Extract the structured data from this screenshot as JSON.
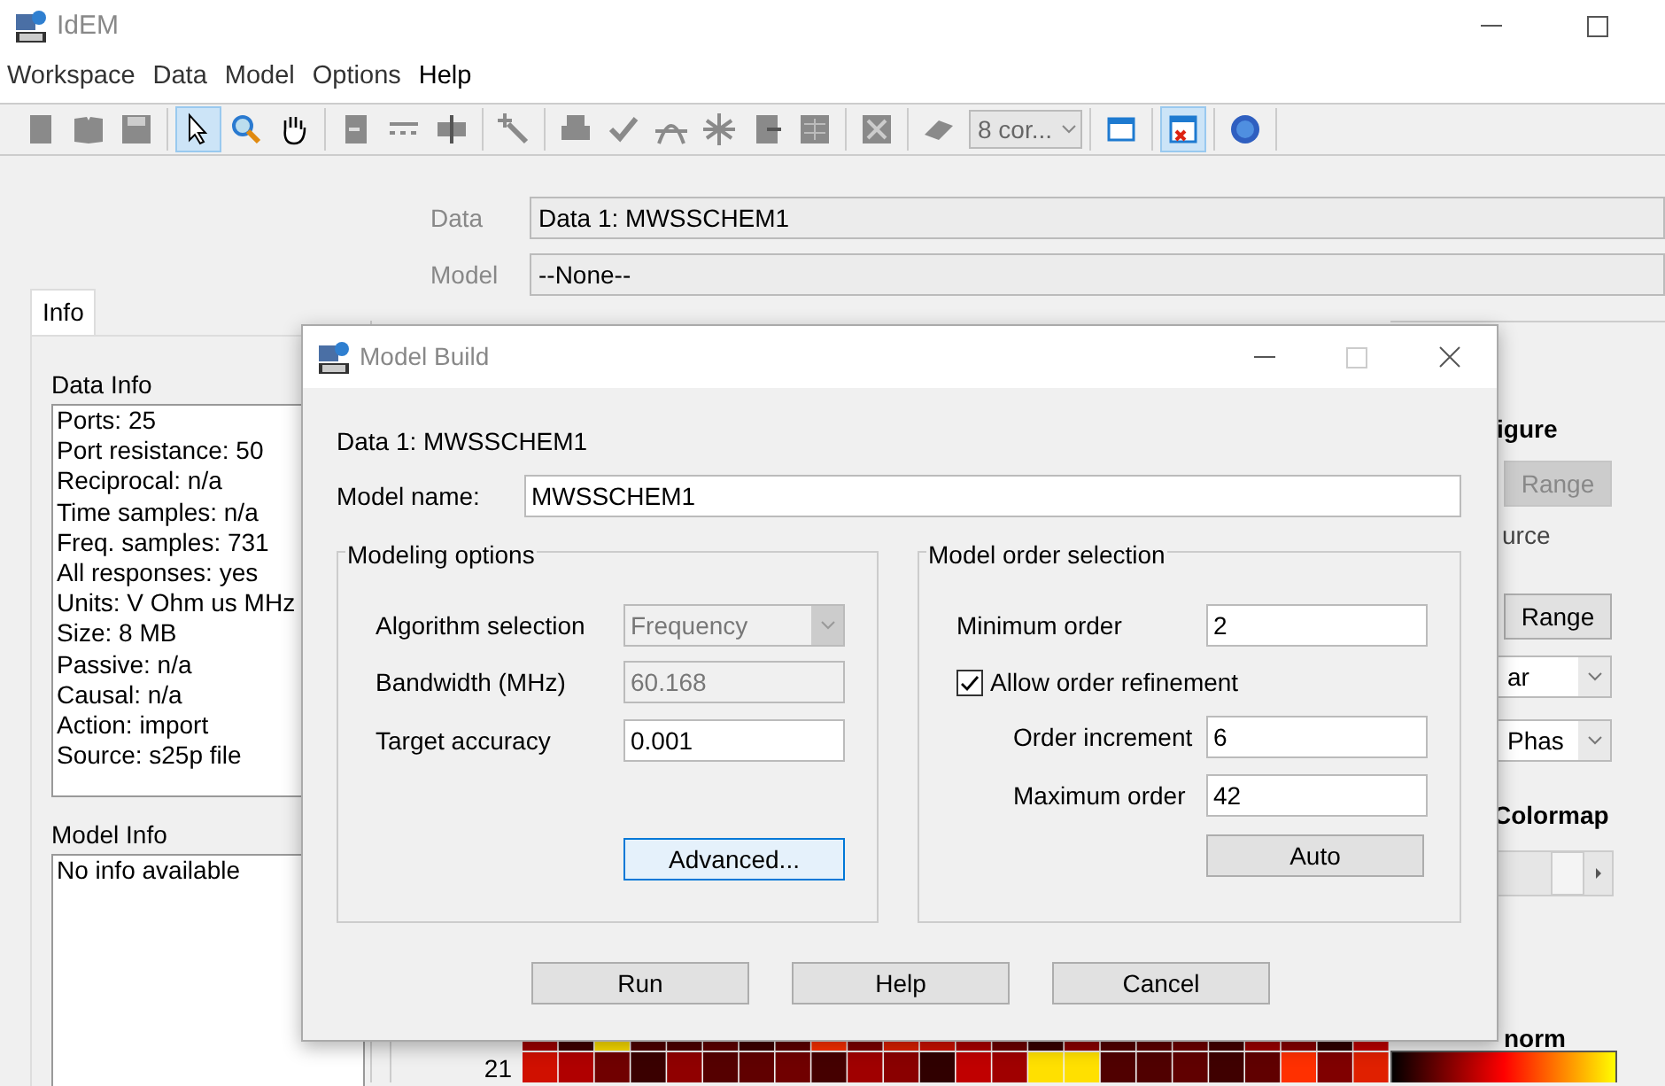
{
  "window": {
    "title": "IdEM"
  },
  "menu": [
    {
      "label": "Workspace",
      "selected": false
    },
    {
      "label": "Data",
      "selected": false
    },
    {
      "label": "Model",
      "selected": false
    },
    {
      "label": "Options",
      "selected": false
    },
    {
      "label": "Help",
      "selected": true
    }
  ],
  "toolbar": [
    [
      {
        "kind": "button",
        "selected": false
      },
      {
        "kind": "button",
        "selected": false
      },
      {
        "kind": "button",
        "selected": false
      }
    ],
    [
      {
        "kind": "button",
        "selected": true
      },
      {
        "kind": "button",
        "selected": false
      },
      {
        "kind": "button",
        "selected": false
      }
    ],
    [
      {
        "kind": "button",
        "selected": false
      },
      {
        "kind": "button",
        "selected": false
      },
      {
        "kind": "button",
        "selected": false
      }
    ],
    [
      {
        "kind": "button",
        "selected": false
      }
    ],
    [
      {
        "kind": "button",
        "selected": false
      },
      {
        "kind": "button",
        "selected": false
      },
      {
        "kind": "button",
        "selected": false
      },
      {
        "kind": "button",
        "selected": false
      },
      {
        "kind": "button",
        "selected": false
      },
      {
        "kind": "button",
        "selected": false
      }
    ],
    [
      {
        "kind": "button",
        "selected": false
      }
    ],
    [
      {
        "kind": "button",
        "selected": false
      },
      {
        "kind": "combo",
        "value": "8 cor..."
      }
    ],
    [
      {
        "kind": "button",
        "selected": false
      }
    ],
    [
      {
        "kind": "button",
        "selected": true
      }
    ],
    [
      {
        "kind": "button",
        "selected": false
      }
    ]
  ],
  "data_selector": {
    "label": "Data",
    "value": "Data 1: MWSSCHEM1"
  },
  "model_selector": {
    "label": "Model",
    "value": "--None--"
  },
  "tabs": [
    {
      "label": "Info",
      "selected": true
    }
  ],
  "data_info": {
    "title": "Data Info",
    "lines": [
      "Ports: 25",
      "Port resistance: 50",
      "Reciprocal: n/a",
      "Time samples: n/a",
      "Freq. samples: 731",
      "All responses: yes",
      "Units: V Ohm us MHz",
      "Size: 8 MB",
      "Passive: n/a",
      "Causal: n/a",
      "Action: import",
      "Source: s25p file"
    ]
  },
  "model_info": {
    "title": "Model Info",
    "lines": [
      "No info available"
    ]
  },
  "right_panel": {
    "figure_label": "igure",
    "range_buttons": [
      {
        "label": "Range",
        "disabled": true
      },
      {
        "label": "Range",
        "disabled": false
      }
    ],
    "source_label": "urce",
    "selects": [
      "ar",
      "Phas"
    ],
    "colormap_label": "Colormap",
    "colorbar_label": "norm"
  },
  "heatmap": {
    "row_label": "21"
  },
  "dialog": {
    "title": "Model Build",
    "data_label": "Data 1: MWSSCHEM1",
    "model_name": {
      "label": "Model name:",
      "value": "MWSSCHEM1"
    },
    "modeling_options": {
      "title": "Modeling options",
      "algorithm": {
        "label": "Algorithm selection",
        "value": "Frequency",
        "disabled": true
      },
      "bandwidth": {
        "label": "Bandwidth (MHz)",
        "value": "60.168",
        "disabled": true
      },
      "accuracy": {
        "label": "Target accuracy",
        "value": "0.001",
        "disabled": false
      },
      "advanced_button": "Advanced..."
    },
    "order_selection": {
      "title": "Model order selection",
      "minimum": {
        "label": "Minimum order",
        "value": "2"
      },
      "refinement": {
        "label": "Allow order refinement",
        "checked": true
      },
      "increment": {
        "label": "Order increment",
        "value": "6"
      },
      "maximum": {
        "label": "Maximum order",
        "value": "42"
      },
      "auto_button": "Auto"
    },
    "buttons": [
      "Run",
      "Help",
      "Cancel"
    ]
  }
}
